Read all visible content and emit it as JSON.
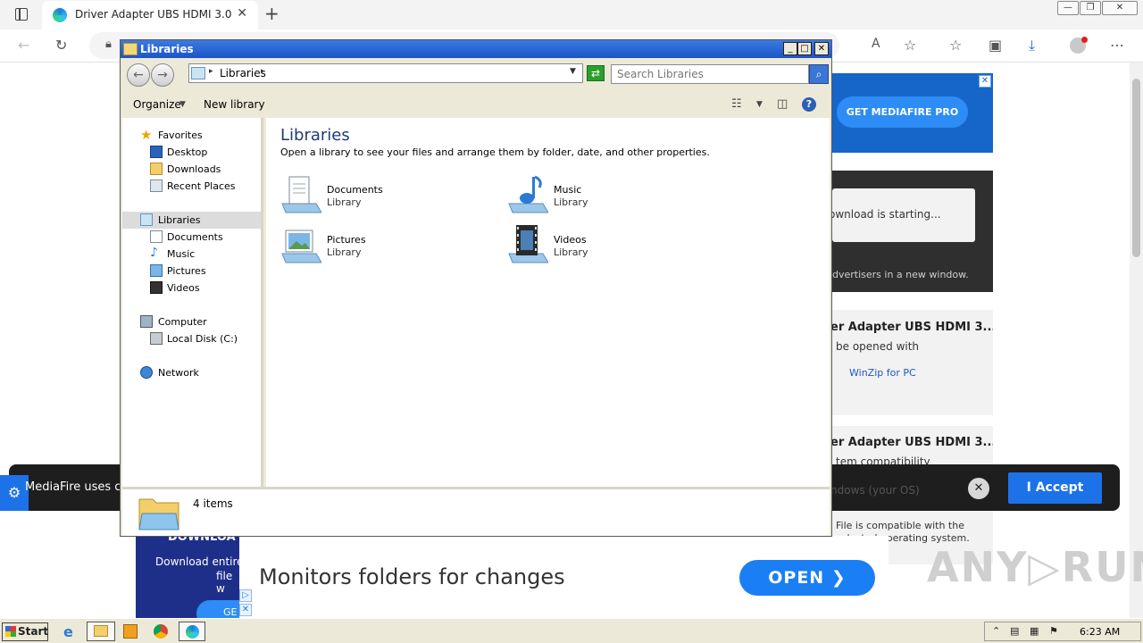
{
  "browser": {
    "tab_title": "Driver Adapter UBS HDMI 3.0",
    "tab_close": "✕",
    "new_tab": "+",
    "window_controls": [
      "—",
      "❐",
      "✕"
    ]
  },
  "webpage": {
    "promo_button": "GET MEDIAFIRE PRO",
    "promo_close": "✕",
    "download_status": "ownload is starting...",
    "advertisers_note": "dvertisers in a new window.",
    "cards": [
      {
        "title": "er Adapter UBS HDMI 3....",
        "line": " be opened with",
        "link": "WinZip for PC"
      },
      {
        "title": "er Adapter UBS HDMI 3....",
        "line": "tem compatibility"
      }
    ],
    "cookie": {
      "text": "MediaFire uses co",
      "faint": "ndows (your OS)",
      "close": "✕",
      "accept": "I Accept"
    },
    "compat_lines": [
      "File is compatible with the",
      "selected operating system."
    ],
    "blue_panel": {
      "title": "DOWNLOA",
      "line1": "Download entire",
      "line2": "file w",
      "button": "GE"
    },
    "ad": {
      "text": "Monitors folders for changes",
      "open": "OPEN ❯"
    },
    "watermark": "ANY▷RUN"
  },
  "explorer": {
    "title": "Libraries",
    "breadcrumb": "Libraries",
    "search_placeholder": "Search Libraries",
    "commands": {
      "organize": "Organize",
      "new_library": "New library"
    },
    "nav": {
      "favorites": "Favorites",
      "favorites_items": [
        "Desktop",
        "Downloads",
        "Recent Places"
      ],
      "libraries": "Libraries",
      "libraries_items": [
        "Documents",
        "Music",
        "Pictures",
        "Videos"
      ],
      "computer": "Computer",
      "computer_items": [
        "Local Disk (C:)"
      ],
      "network": "Network"
    },
    "heading": "Libraries",
    "subheading": "Open a library to see your files and arrange them by folder, date, and other properties.",
    "libraries": [
      {
        "name": "Documents",
        "type": "Library",
        "icon": "documents-library-icon"
      },
      {
        "name": "Music",
        "type": "Library",
        "icon": "music-library-icon"
      },
      {
        "name": "Pictures",
        "type": "Library",
        "icon": "pictures-library-icon"
      },
      {
        "name": "Videos",
        "type": "Library",
        "icon": "videos-library-icon"
      }
    ],
    "status": "4 items"
  },
  "taskbar": {
    "start": "Start",
    "clock": "6:23 AM"
  },
  "colors": {
    "titlebar": "#1c54c8",
    "accent_blue": "#1d72e8",
    "ad_open": "#1a7ef5"
  }
}
